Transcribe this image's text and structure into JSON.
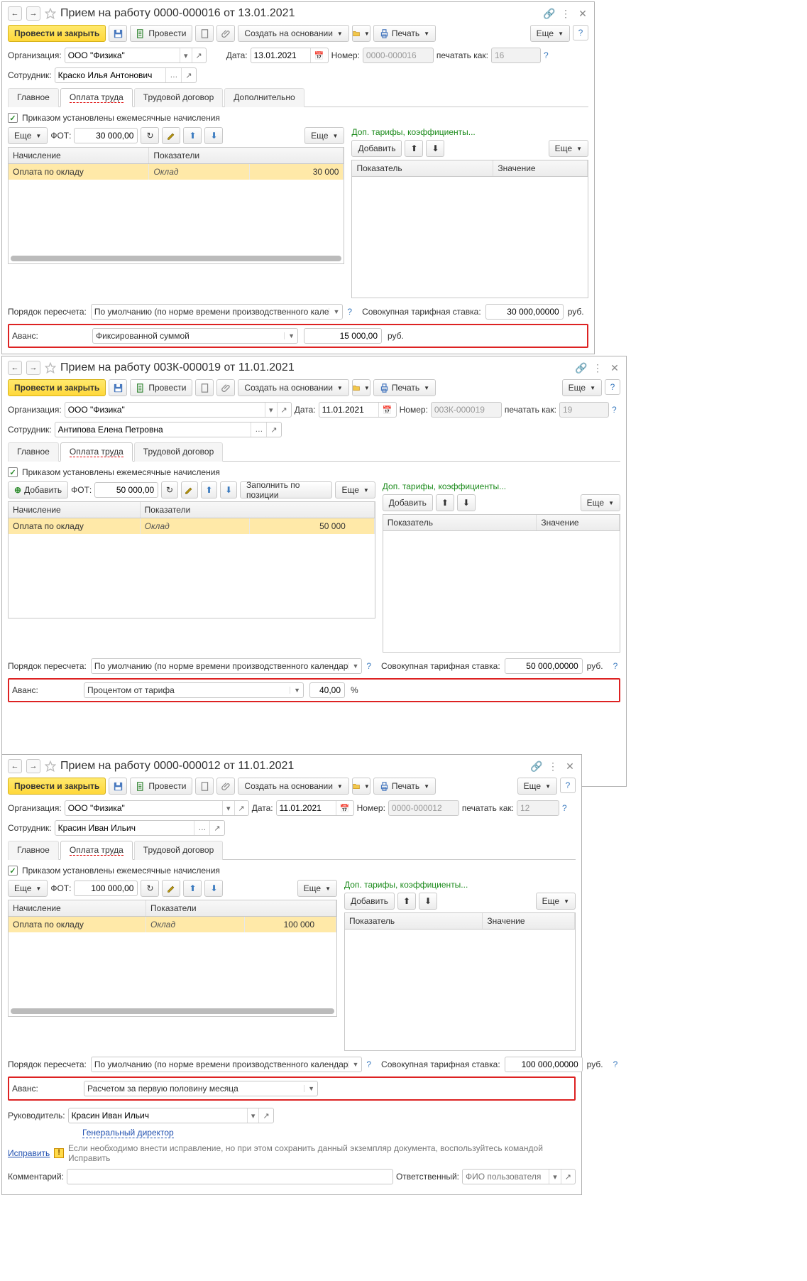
{
  "common": {
    "post_and_close": "Провести и закрыть",
    "post": "Провести",
    "create_on_basis": "Создать на основании",
    "print": "Печать",
    "more": "Еще",
    "org_lbl": "Организация:",
    "org_val": "ООО \"Физика\"",
    "emp_lbl": "Сотрудник:",
    "date_lbl": "Дата:",
    "num_lbl": "Номер:",
    "print_as_lbl": "печатать как:",
    "tab_main": "Главное",
    "tab_pay": "Оплата труда",
    "tab_contract": "Трудовой договор",
    "tab_extra": "Дополнительно",
    "chk_label": "Приказом установлены ежемесячные начисления",
    "fot_lbl": "ФОТ:",
    "add_btn": "Добавить",
    "fill_pos": "Заполнить по позиции",
    "col_accrual": "Начисление",
    "col_indicators": "Показатели",
    "accr_val": "Оплата по окладу",
    "ind_name": "Оклад",
    "green_link": "Доп. тарифы, коэффициенты...",
    "col_indicator": "Показатель",
    "col_value": "Значение",
    "recalc_lbl": "Порядок пересчета:",
    "recalc_full": "По умолчанию (по норме времени производственного календаря)",
    "recalc_trunc": "По умолчанию (по норме времени производственного кале",
    "recalc_trunc2": "По умолчанию (по норме времени производственного календар",
    "rate_lbl": "Совокупная тарифная ставка:",
    "rub": "руб.",
    "pct": "%",
    "avans_lbl": "Аванс:",
    "avans_fixed": "Фиксированной суммой",
    "avans_percent": "Процентом от тарифа",
    "avans_half": "Расчетом за первую половину месяца",
    "manager_lbl": "Руководитель:",
    "manager_role": "Генеральный директор",
    "fix_link": "Исправить",
    "warn_text": "Если необходимо внести исправление, но при этом сохранить данный экземпляр документа, воспользуйтесь командой Исправить",
    "comment_lbl": "Комментарий:",
    "resp_lbl": "Ответственный:",
    "resp_placeholder": "ФИО пользователя"
  },
  "w1": {
    "title": "Прием на работу 0000-000016 от 13.01.2021",
    "date": "13.01.2021",
    "number": "0000-000016",
    "print_num": "16",
    "employee": "Краско Илья Антонович",
    "fot": "30 000,00",
    "ind_val": "30 000",
    "rate": "30 000,00000",
    "avans_amount": "15 000,00"
  },
  "w2": {
    "title": "Прием на работу 003К-000019 от 11.01.2021",
    "date": "11.01.2021",
    "number": "003К-000019",
    "print_num": "19",
    "employee": "Антипова Елена Петровна",
    "fot": "50 000,00",
    "ind_val": "50 000",
    "rate": "50 000,00000",
    "avans_pct": "40,00"
  },
  "w3": {
    "title": "Прием на работу 0000-000012 от 11.01.2021",
    "date": "11.01.2021",
    "number": "0000-000012",
    "print_num": "12",
    "employee": "Красин Иван Ильич",
    "fot": "100 000,00",
    "ind_val": "100 000",
    "rate": "100 000,00000",
    "manager": "Красин Иван Ильич"
  }
}
